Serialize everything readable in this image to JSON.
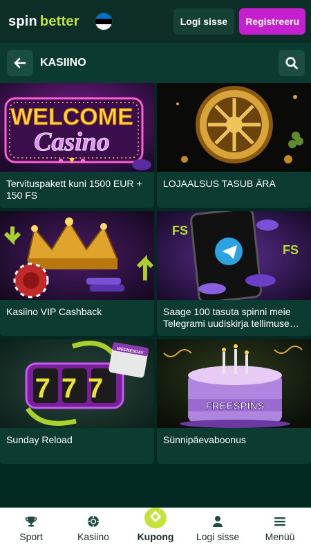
{
  "header": {
    "logo_part1": "spin",
    "logo_part2": "better",
    "flag_colors": [
      "#0072ce",
      "#000000",
      "#ffffff"
    ],
    "login_label": "Logi sisse",
    "register_label": "Registreeru"
  },
  "subheader": {
    "back_icon": "arrow-left-icon",
    "title": "KASIINO",
    "search_icon": "search-icon"
  },
  "promos": [
    {
      "title": "Tervituspakett kuni 1500 EUR + 150 FS",
      "image_text_1": "WELCOME",
      "image_text_2": "Casino"
    },
    {
      "title": "LOJAALSUS TASUB ÄRA"
    },
    {
      "title": "Kasiino VIP Cashback"
    },
    {
      "title": "Saage 100 tasuta spinni meie Telegrami uudiskirja tellimuse…",
      "image_text_1": "FS",
      "image_text_2": "FS"
    },
    {
      "title": "Sunday Reload",
      "image_text_1": "777",
      "image_text_2": "WEDNESDAY"
    },
    {
      "title": "Sünnipäevaboonus",
      "image_text_1": "FREESPINS"
    }
  ],
  "bottom_nav": [
    {
      "label": "Sport",
      "icon": "trophy-icon"
    },
    {
      "label": "Kasiino",
      "icon": "chip-icon"
    },
    {
      "label": "Kupong",
      "icon": "coupon-icon",
      "active": true
    },
    {
      "label": "Logi sisse",
      "icon": "user-icon"
    },
    {
      "label": "Menüü",
      "icon": "menu-icon"
    }
  ],
  "colors": {
    "accent_green": "#c3e23a",
    "register_magenta": "#c51fcf",
    "background": "#032a22"
  }
}
